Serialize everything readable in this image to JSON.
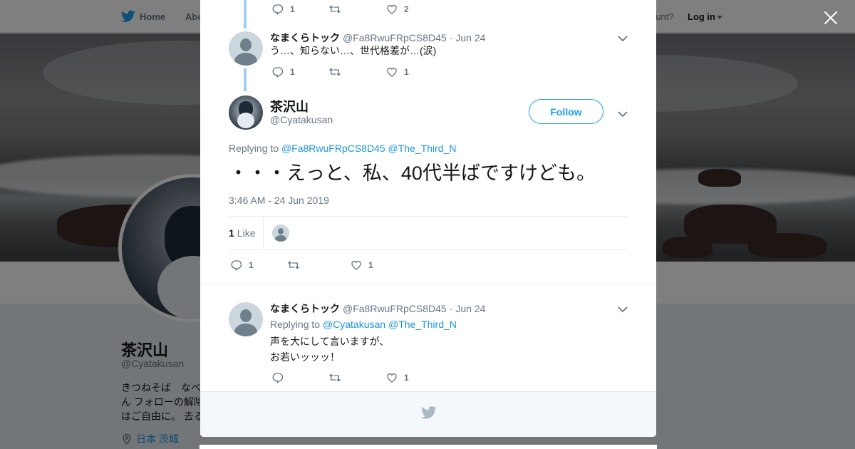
{
  "background": {
    "nav": {
      "home_label": "Home",
      "about_label": "Abo",
      "account_text": "ccount?",
      "login_label": "Log in"
    },
    "profile": {
      "name": "茶沢山",
      "handle": "@Cyatakusan",
      "bio_lines": [
        "きつねそば　なべ",
        "ん フォローの解除",
        "はご自由に。 去る"
      ],
      "location": "日本 茨城"
    }
  },
  "modal": {
    "prev_actions": {
      "reply": "1",
      "retweet": "",
      "like": "2"
    },
    "tweet_above": {
      "name": "なまくらトック",
      "handle": "@Fa8RwuFRpCS8D45",
      "date": "Jun 24",
      "text": "う…、知らない…、世代格差が…(涙)",
      "reply_count": "1",
      "retweet_count": "",
      "like_count": "1"
    },
    "main_tweet": {
      "name": "茶沢山",
      "handle": "@Cyatakusan",
      "follow_label": "Follow",
      "replying_prefix": "Replying to",
      "replying_to": [
        "@Fa8RwuFRpCS8D45",
        "@The_Third_N"
      ],
      "text": "・・・えっと、私、40代半ばですけども。",
      "timestamp": "3:46 AM - 24 Jun 2019",
      "likes_count": "1",
      "likes_label": "Like",
      "reply_count": "1",
      "retweet_count": "",
      "like_count": "1"
    },
    "reply_tweet": {
      "name": "なまくらトック",
      "handle": "@Fa8RwuFRpCS8D45",
      "date": "Jun 24",
      "replying_prefix": "Replying to",
      "replying_to": [
        "@Cyatakusan",
        "@The_Third_N"
      ],
      "text_lines": [
        "声を大にして言いますが、",
        "お若いッッッ！"
      ],
      "reply_count": "",
      "retweet_count": "",
      "like_count": "1"
    }
  },
  "colors": {
    "accent": "#1da1f2",
    "link": "#1b95e0",
    "thread_line": "#9ecff2",
    "muted": "#657786"
  }
}
